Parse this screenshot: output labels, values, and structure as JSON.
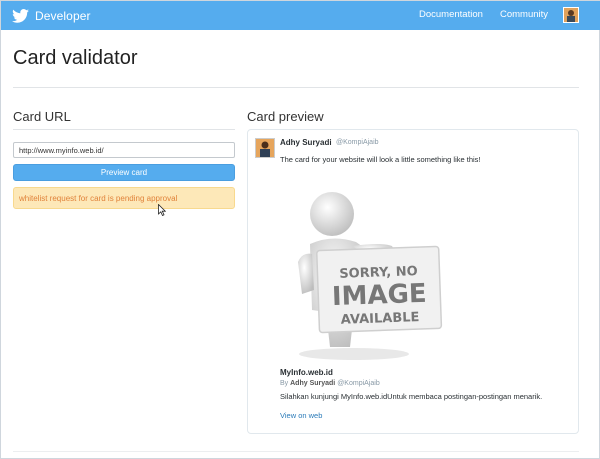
{
  "topbar": {
    "brand": "Developer",
    "nav": {
      "documentation": "Documentation",
      "community": "Community"
    },
    "bg_color": "#55acee"
  },
  "page": {
    "title": "Card validator"
  },
  "left": {
    "section_title": "Card URL",
    "url_value": "http://www.myinfo.web.id/",
    "preview_button": "Preview card",
    "alert": "whitelist request for card is pending approval"
  },
  "right": {
    "section_title": "Card preview",
    "card": {
      "author_name": "Adhy Suryadi",
      "author_handle": "@KompiAjaib",
      "intro_text": "The card for your website will look a little something like this!",
      "image": {
        "line1": "SORRY, NO",
        "line2": "IMAGE",
        "line3": "AVAILABLE"
      },
      "link_title": "MyInfo.web.id",
      "by_prefix": "By",
      "by_name": "Adhy Suryadi",
      "by_handle": "@KompiAjaib",
      "description": "Silahkan kunjungi MyInfo.web.idUntuk membaca postingan-postingan menarik.",
      "view_link": "View on web"
    }
  },
  "colors": {
    "accent": "#55acee",
    "alert_bg": "#fde8b8",
    "alert_text": "#e0823a",
    "link": "#2b7bb9"
  }
}
